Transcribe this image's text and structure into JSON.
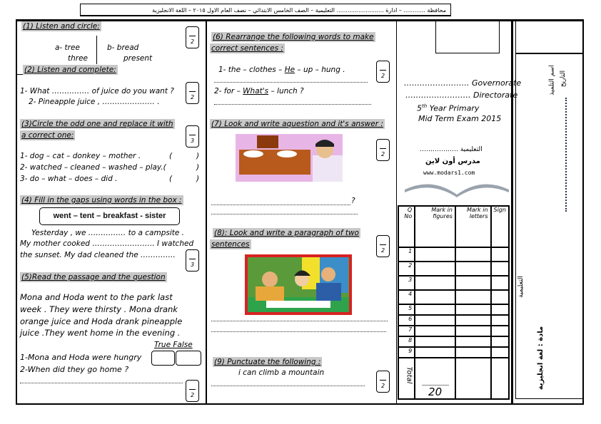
{
  "header": {
    "text": "محافظة ............ – ادارة .......................... التعليمية – الصف الخامس الابتدائي – نصف العام الاول ٢٠١٥ – اللغة الانجليزية"
  },
  "q1": {
    "title": "(1) Listen and circle:",
    "a": "a- tree",
    "a2": "three",
    "b": "b- bread",
    "b2": "present",
    "mark": "2"
  },
  "q2": {
    "title": "(2) Listen and complete:",
    "l1": "1- What …………… of juice do you want ?",
    "l2": "2- Pineapple juice , ………………… .",
    "mark": "2"
  },
  "q3": {
    "title1": "(3)Circle the odd one and replace it with",
    "title2": "a correct one:",
    "l1": "1- dog – cat – donkey – mother .",
    "l2": "2- watched – cleaned – washed – play.(",
    "l3": "3- do – what – does – did .",
    "paren_open": "(",
    "paren_close": ")",
    "mark": "3"
  },
  "q4": {
    "title": "(4) Fill in the gaps using words in the box :",
    "box": "went – tent – breakfast - sister",
    "l1": "Yesterday , we …………… to a campsite .",
    "l2": "My mother cooked ……………………. I watched",
    "l3": "the sunset. My dad cleaned the …………..",
    "mark": "3"
  },
  "q5": {
    "title": "(5)Read the passage and the question",
    "p1": "Mona and Hoda went to the park last",
    "p2": "week . They were thirsty . Mona drank",
    "p3": "orange juice and Hoda drank pineapple",
    "p4": "juice .They went home in the evening .",
    "tf": "True False",
    "s1": "1-Mona and Hoda were hungry",
    "s2": "2-When did they go home ?",
    "mark": "2"
  },
  "q6": {
    "title1": "(6) Rearrange the following words to make",
    "title2": "correct sentences :",
    "l1a": "1- the – clothes – ",
    "l1u": "He",
    "l1b": " – up – hung .",
    "l2a": "2- for – ",
    "l2u": "What's",
    "l2b": " – lunch ?",
    "mark": "2"
  },
  "q7": {
    "title": "(7) Look and write aquestion and it's answer :",
    "q_end": "?",
    "mark": "2"
  },
  "q8": {
    "title1": "(8): Look and write a paragraph of two",
    "title2": "sentences",
    "mark": "2"
  },
  "q9": {
    "title": "(9) Punctuate the following :",
    "sentence": "i can climb a mountain",
    "mark": "2"
  },
  "info": {
    "gov": "……………………. Governorate",
    "dir": "……………………. Directorate",
    "year_num": "5",
    "year_sup": "th",
    "year_rest": " Year Primary",
    "exam": "Mid Term Exam 2015",
    "edu": "التعليمية ………………",
    "site": "www.modars1.com",
    "logo": "مدرس أون لاين"
  },
  "side": {
    "subject": "مادة : لغة انجليزية",
    "edu": "التعليمية",
    "name": "اسم التلميذ",
    "date": "التاريخ"
  },
  "table": {
    "headers": [
      "Q No",
      "Mark in figures",
      "Mark in letters",
      "Sign"
    ],
    "rows": [
      "1",
      "2",
      "3",
      "4",
      "5",
      "6",
      "7",
      "8",
      "9"
    ],
    "total": "Total",
    "total_value": "20"
  }
}
